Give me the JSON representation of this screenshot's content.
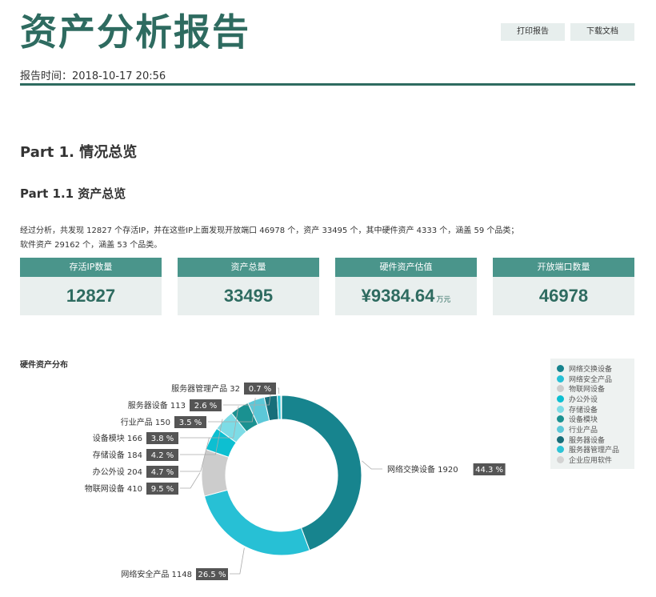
{
  "header": {
    "title": "资产分析报告",
    "print_label": "打印报告",
    "download_label": "下载文档",
    "report_time": "报告时间：2018-10-17 20:56"
  },
  "part1": {
    "heading": "Part 1. 情况总览",
    "sub_heading": "Part 1.1 资产总览",
    "summary_line1": "经过分析，共发现 12827 个存活IP，并在这些IP上面发现开放端口 46978 个，资产 33495 个，其中硬件资产 4333 个，涵盖 59 个品类；",
    "summary_line2": "软件资产 29162 个，涵盖 53 个品类。"
  },
  "cards": [
    {
      "label": "存活IP数量",
      "value": "12827",
      "unit": ""
    },
    {
      "label": "资产总量",
      "value": "33495",
      "unit": ""
    },
    {
      "label": "硬件资产估值",
      "value": "¥9384.64",
      "unit": "万元"
    },
    {
      "label": "开放端口数量",
      "value": "46978",
      "unit": ""
    }
  ],
  "colors": {
    "accent": "#2e6b60",
    "card_header": "#4a958b",
    "card_bg": "#e9efee"
  },
  "chart_title": "硬件资产分布",
  "chart_data": {
    "type": "pie",
    "donut": true,
    "legend_position": "top-right",
    "categories": [
      "网络交换设备",
      "网络安全产品",
      "物联网设备",
      "办公外设",
      "存储设备",
      "设备模块",
      "行业产品",
      "服务器设备",
      "服务器管理产品",
      "企业应用软件"
    ],
    "values": [
      1920,
      1148,
      410,
      204,
      184,
      166,
      150,
      113,
      32,
      6
    ],
    "percent_labels": [
      "44.3 %",
      "26.5 %",
      "9.5 %",
      "4.7 %",
      "4.2 %",
      "3.8 %",
      "3.5 %",
      "2.6 %",
      "0.7 %",
      ""
    ],
    "colors": [
      "#17848e",
      "#27c0d5",
      "#cccccc",
      "#0dbfd1",
      "#7ddce6",
      "#1a9191",
      "#5cc8d8",
      "#176e7a",
      "#2ec4d6",
      "#d3d3d3"
    ]
  }
}
